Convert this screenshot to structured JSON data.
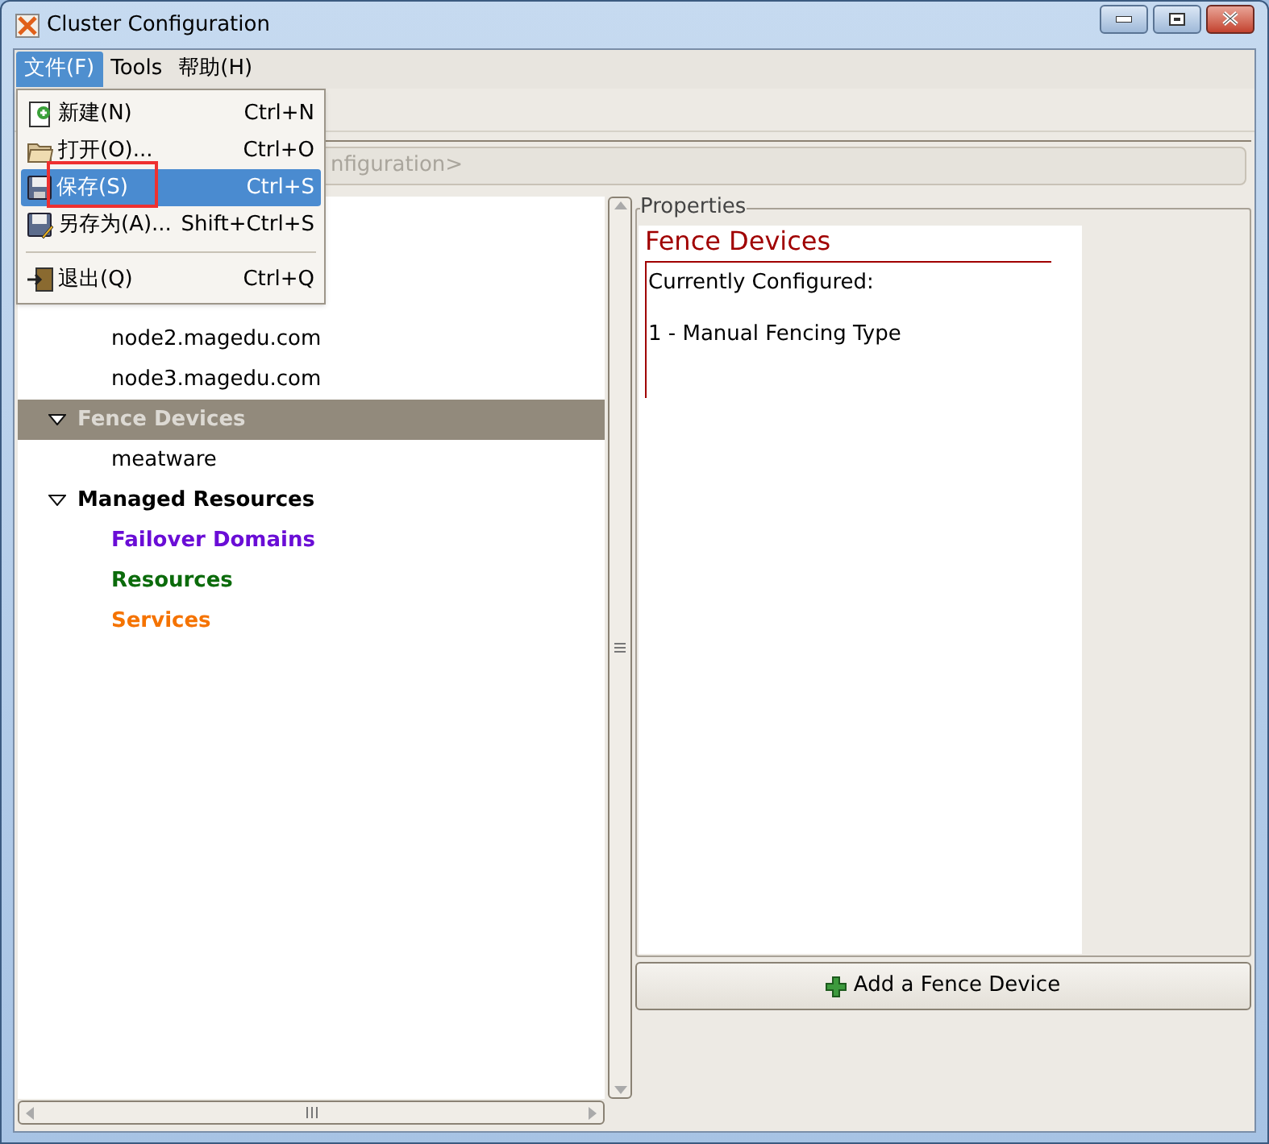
{
  "window": {
    "title": "Cluster Configuration"
  },
  "menu_bar": [
    {
      "label": "文件(F)",
      "selected": true
    },
    {
      "label": "Tools",
      "selected": false
    },
    {
      "label": "帮助(H)",
      "selected": false
    }
  ],
  "file_menu": [
    {
      "kind": "item",
      "label": "新建(N)",
      "shortcut": "Ctrl+N",
      "selected": false
    },
    {
      "kind": "item",
      "label": "打开(O)...",
      "shortcut": "Ctrl+O",
      "selected": false
    },
    {
      "kind": "item",
      "label": "保存(S)",
      "shortcut": "Ctrl+S",
      "selected": true
    },
    {
      "kind": "item",
      "label": "另存为(A)...",
      "shortcut": "Shift+Ctrl+S",
      "selected": false
    },
    {
      "kind": "separator"
    },
    {
      "kind": "item",
      "label": "退出(Q)",
      "shortcut": "Ctrl+Q",
      "selected": false
    }
  ],
  "breadcrumb": {
    "value": "nfiguration>"
  },
  "tree": [
    {
      "children": [
        {
          "label": "node2.magedu.com",
          "selected": false
        },
        {
          "label": "node3.magedu.com",
          "selected": false
        }
      ]
    },
    {
      "label": "Fence Devices",
      "expanded": true,
      "selected": true,
      "children": [
        {
          "label": "meatware",
          "selected": false
        }
      ]
    },
    {
      "label": "Managed Resources",
      "expanded": true,
      "selected": false,
      "children": [
        {
          "label": "Failover Domains",
          "selected": false,
          "color": "#6a0dd6"
        },
        {
          "label": "Resources",
          "selected": false,
          "color": "#0b6b0b"
        },
        {
          "label": "Services",
          "selected": false,
          "color": "#f57300"
        }
      ]
    }
  ],
  "properties": {
    "title": "Properties",
    "heading": "Fence Devices",
    "lines": [
      "Currently Configured:",
      "1 - Manual Fencing Type"
    ]
  },
  "add_button": {
    "label": "Add a Fence Device"
  }
}
